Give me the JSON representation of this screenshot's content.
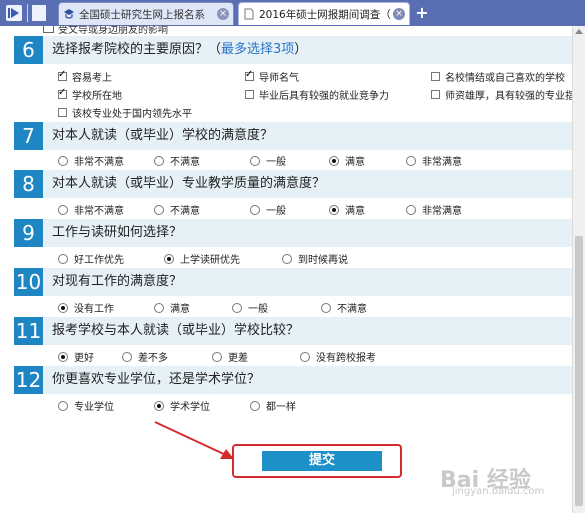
{
  "browser": {
    "tabs": [
      {
        "label": "全国硕士研究生网上报名系",
        "active": false
      },
      {
        "label": "2016年硕士网报期间调查（",
        "active": true
      }
    ],
    "new_tab_label": "+"
  },
  "form": {
    "partial_top_option": "受文导或身边朋友的影响",
    "q6": {
      "number": "6",
      "title": "选择报考院校的主要原因？（",
      "note": "最多选择3项",
      "title_end": "）",
      "options": [
        {
          "label": "容易考上",
          "checked": true
        },
        {
          "label": "导师名气",
          "checked": true
        },
        {
          "label": "名校情结或自己喜欢的学校",
          "checked": false
        },
        {
          "label": "学校所在地",
          "checked": true
        },
        {
          "label": "毕业后具有较强的就业竞争力",
          "checked": false
        },
        {
          "label": "师资雄厚，具有较强的专业指",
          "checked": false
        },
        {
          "label": "该校专业处于国内领先水平",
          "checked": false
        }
      ]
    },
    "q7": {
      "number": "7",
      "title": "对本人就读（或毕业）学校的满意度？",
      "options": [
        {
          "label": "非常不满意",
          "selected": false
        },
        {
          "label": "不满意",
          "selected": false
        },
        {
          "label": "一般",
          "selected": false
        },
        {
          "label": "满意",
          "selected": true
        },
        {
          "label": "非常满意",
          "selected": false
        }
      ]
    },
    "q8": {
      "number": "8",
      "title": "对本人就读（或毕业）专业教学质量的满意度？",
      "options": [
        {
          "label": "非常不满意",
          "selected": false
        },
        {
          "label": "不满意",
          "selected": false
        },
        {
          "label": "一般",
          "selected": false
        },
        {
          "label": "满意",
          "selected": true
        },
        {
          "label": "非常满意",
          "selected": false
        }
      ]
    },
    "q9": {
      "number": "9",
      "title": "工作与读研如何选择？",
      "options": [
        {
          "label": "好工作优先",
          "selected": false
        },
        {
          "label": "上学读研优先",
          "selected": true
        },
        {
          "label": "到时候再说",
          "selected": false
        }
      ]
    },
    "q10": {
      "number": "10",
      "title": "对现有工作的满意度？",
      "options": [
        {
          "label": "没有工作",
          "selected": true
        },
        {
          "label": "满意",
          "selected": false
        },
        {
          "label": "一般",
          "selected": false
        },
        {
          "label": "不满意",
          "selected": false
        }
      ]
    },
    "q11": {
      "number": "11",
      "title": "报考学校与本人就读（或毕业）学校比较？",
      "options": [
        {
          "label": "更好",
          "selected": true
        },
        {
          "label": "差不多",
          "selected": false
        },
        {
          "label": "更差",
          "selected": false
        },
        {
          "label": "没有跨校报考",
          "selected": false
        }
      ]
    },
    "q12": {
      "number": "12",
      "title": "你更喜欢专业学位，还是学术学位？",
      "options": [
        {
          "label": "专业学位",
          "selected": false
        },
        {
          "label": "学术学位",
          "selected": true
        },
        {
          "label": "都一样",
          "selected": false
        }
      ]
    },
    "submit_label": "提交"
  },
  "watermark": {
    "main": "Bai 经验",
    "sub": "jingyan.baidu.com"
  },
  "colors": {
    "accent": "#1e86c3",
    "header_bg": "#e6f1f7",
    "highlight": "#d42c2c",
    "tabbar": "#5a6fb3"
  }
}
